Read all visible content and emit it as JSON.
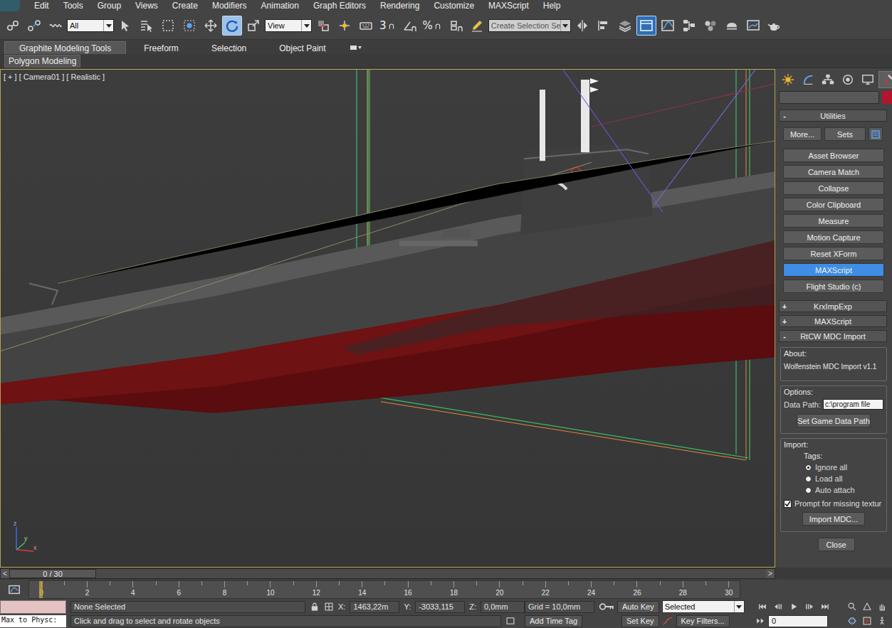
{
  "menu": [
    "Edit",
    "Tools",
    "Group",
    "Views",
    "Create",
    "Modifiers",
    "Animation",
    "Graph Editors",
    "Rendering",
    "Customize",
    "MAXScript",
    "Help"
  ],
  "toolbar": [
    {
      "kind": "button",
      "selected": false
    },
    {
      "kind": "button",
      "selected": false
    },
    {
      "kind": "button",
      "selected": false
    },
    {
      "kind": "dropdown",
      "value": "All"
    },
    {
      "kind": "button",
      "selected": false
    },
    {
      "kind": "button",
      "selected": false
    },
    {
      "kind": "button",
      "selected": false
    },
    {
      "kind": "button",
      "selected": false
    },
    {
      "kind": "button",
      "selected": false
    },
    {
      "kind": "button",
      "selected": true
    },
    {
      "kind": "button",
      "selected": false
    },
    {
      "kind": "dropdown",
      "value": "View"
    },
    {
      "kind": "button",
      "selected": false
    },
    {
      "kind": "button",
      "selected": false
    },
    {
      "kind": "button",
      "selected": false
    },
    {
      "kind": "snap",
      "label": "3"
    },
    {
      "kind": "button",
      "selected": false
    },
    {
      "kind": "snap",
      "label": "%"
    },
    {
      "kind": "button",
      "selected": false
    },
    {
      "kind": "button",
      "selected": false
    },
    {
      "kind": "field",
      "value": "Create Selection Se"
    },
    {
      "kind": "button",
      "selected": false
    },
    {
      "kind": "button",
      "selected": false
    },
    {
      "kind": "button",
      "selected": false
    },
    {
      "kind": "button",
      "selected": true
    },
    {
      "kind": "button",
      "selected": false
    },
    {
      "kind": "button",
      "selected": false
    },
    {
      "kind": "button",
      "selected": false
    },
    {
      "kind": "button",
      "selected": false
    },
    {
      "kind": "button",
      "selected": false
    },
    {
      "kind": "button",
      "selected": false
    }
  ],
  "ribbon": {
    "tabs": [
      {
        "label": "Graphite Modeling Tools",
        "selected": true
      },
      {
        "label": "Freeform",
        "selected": false
      },
      {
        "label": "Selection",
        "selected": false
      },
      {
        "label": "Object Paint",
        "selected": false
      }
    ],
    "panel_label": "Polygon Modeling"
  },
  "viewport": {
    "label": "[ + ] [ Camera01 ] [ Realistic ]",
    "axes": [
      "z",
      "y",
      "x"
    ]
  },
  "command_panel": {
    "tabs": [
      {
        "selected": false
      },
      {
        "selected": false
      },
      {
        "selected": false
      },
      {
        "selected": false
      },
      {
        "selected": false
      },
      {
        "selected": true
      }
    ],
    "name_field": "",
    "utilities": {
      "sign": "-",
      "title": "Utilities",
      "top_buttons": [
        "More...",
        "Sets"
      ],
      "items": [
        {
          "label": "Asset Browser",
          "selected": false
        },
        {
          "label": "Camera Match",
          "selected": false
        },
        {
          "label": "Collapse",
          "selected": false
        },
        {
          "label": "Color Clipboard",
          "selected": false
        },
        {
          "label": "Measure",
          "selected": false
        },
        {
          "label": "Motion Capture",
          "selected": false
        },
        {
          "label": "Reset XForm",
          "selected": false
        },
        {
          "label": "MAXScript",
          "selected": true
        },
        {
          "label": "Flight Studio (c)",
          "selected": false
        }
      ]
    },
    "rollouts": [
      {
        "sign": "+",
        "title": "KrxImpExp"
      },
      {
        "sign": "+",
        "title": "MAXScript"
      },
      {
        "sign": "-",
        "title": "RtCW MDC Import"
      }
    ],
    "mdc": {
      "about_title": "About:",
      "about": "Wolfenstein MDC Import v1.1",
      "options_title": "Options:",
      "data_path_label": "Data Path:",
      "data_path": "c:\\program file",
      "set_path": "Set Game Data Path",
      "import_title": "Import:",
      "tags_label": "Tags:",
      "tags": [
        {
          "label": "Ignore all",
          "selected": true
        },
        {
          "label": "Load all",
          "selected": false
        },
        {
          "label": "Auto attach",
          "selected": false
        }
      ],
      "prompt": {
        "label": "Prompt for missing textur",
        "checked": true
      },
      "import_button": "Import MDC...",
      "close": "Close"
    }
  },
  "time_slider": {
    "prev": "<",
    "label": "0 / 30",
    "next": ">",
    "level": 0
  },
  "track": {
    "labels": [
      "0",
      "2",
      "4",
      "6",
      "8",
      "10",
      "12",
      "14",
      "16",
      "18",
      "20",
      "22",
      "24",
      "26",
      "28",
      "30"
    ],
    "level": 0
  },
  "status": {
    "script_field": "Max to Physc:",
    "selection": "None Selected",
    "x_label": "X:",
    "x": "1463,22m",
    "y_label": "Y:",
    "y": "-3033,115",
    "z_label": "Z:",
    "z": "0,0mm",
    "grid": "Grid = 10,0mm",
    "auto_key": "Auto Key",
    "key_mode": "Selected",
    "set_key": "Set Key",
    "key_filters": "Key Filters...",
    "frame": "0",
    "prompt": "Click and drag to select and rotate objects",
    "time_tag": "Add Time Tag"
  }
}
